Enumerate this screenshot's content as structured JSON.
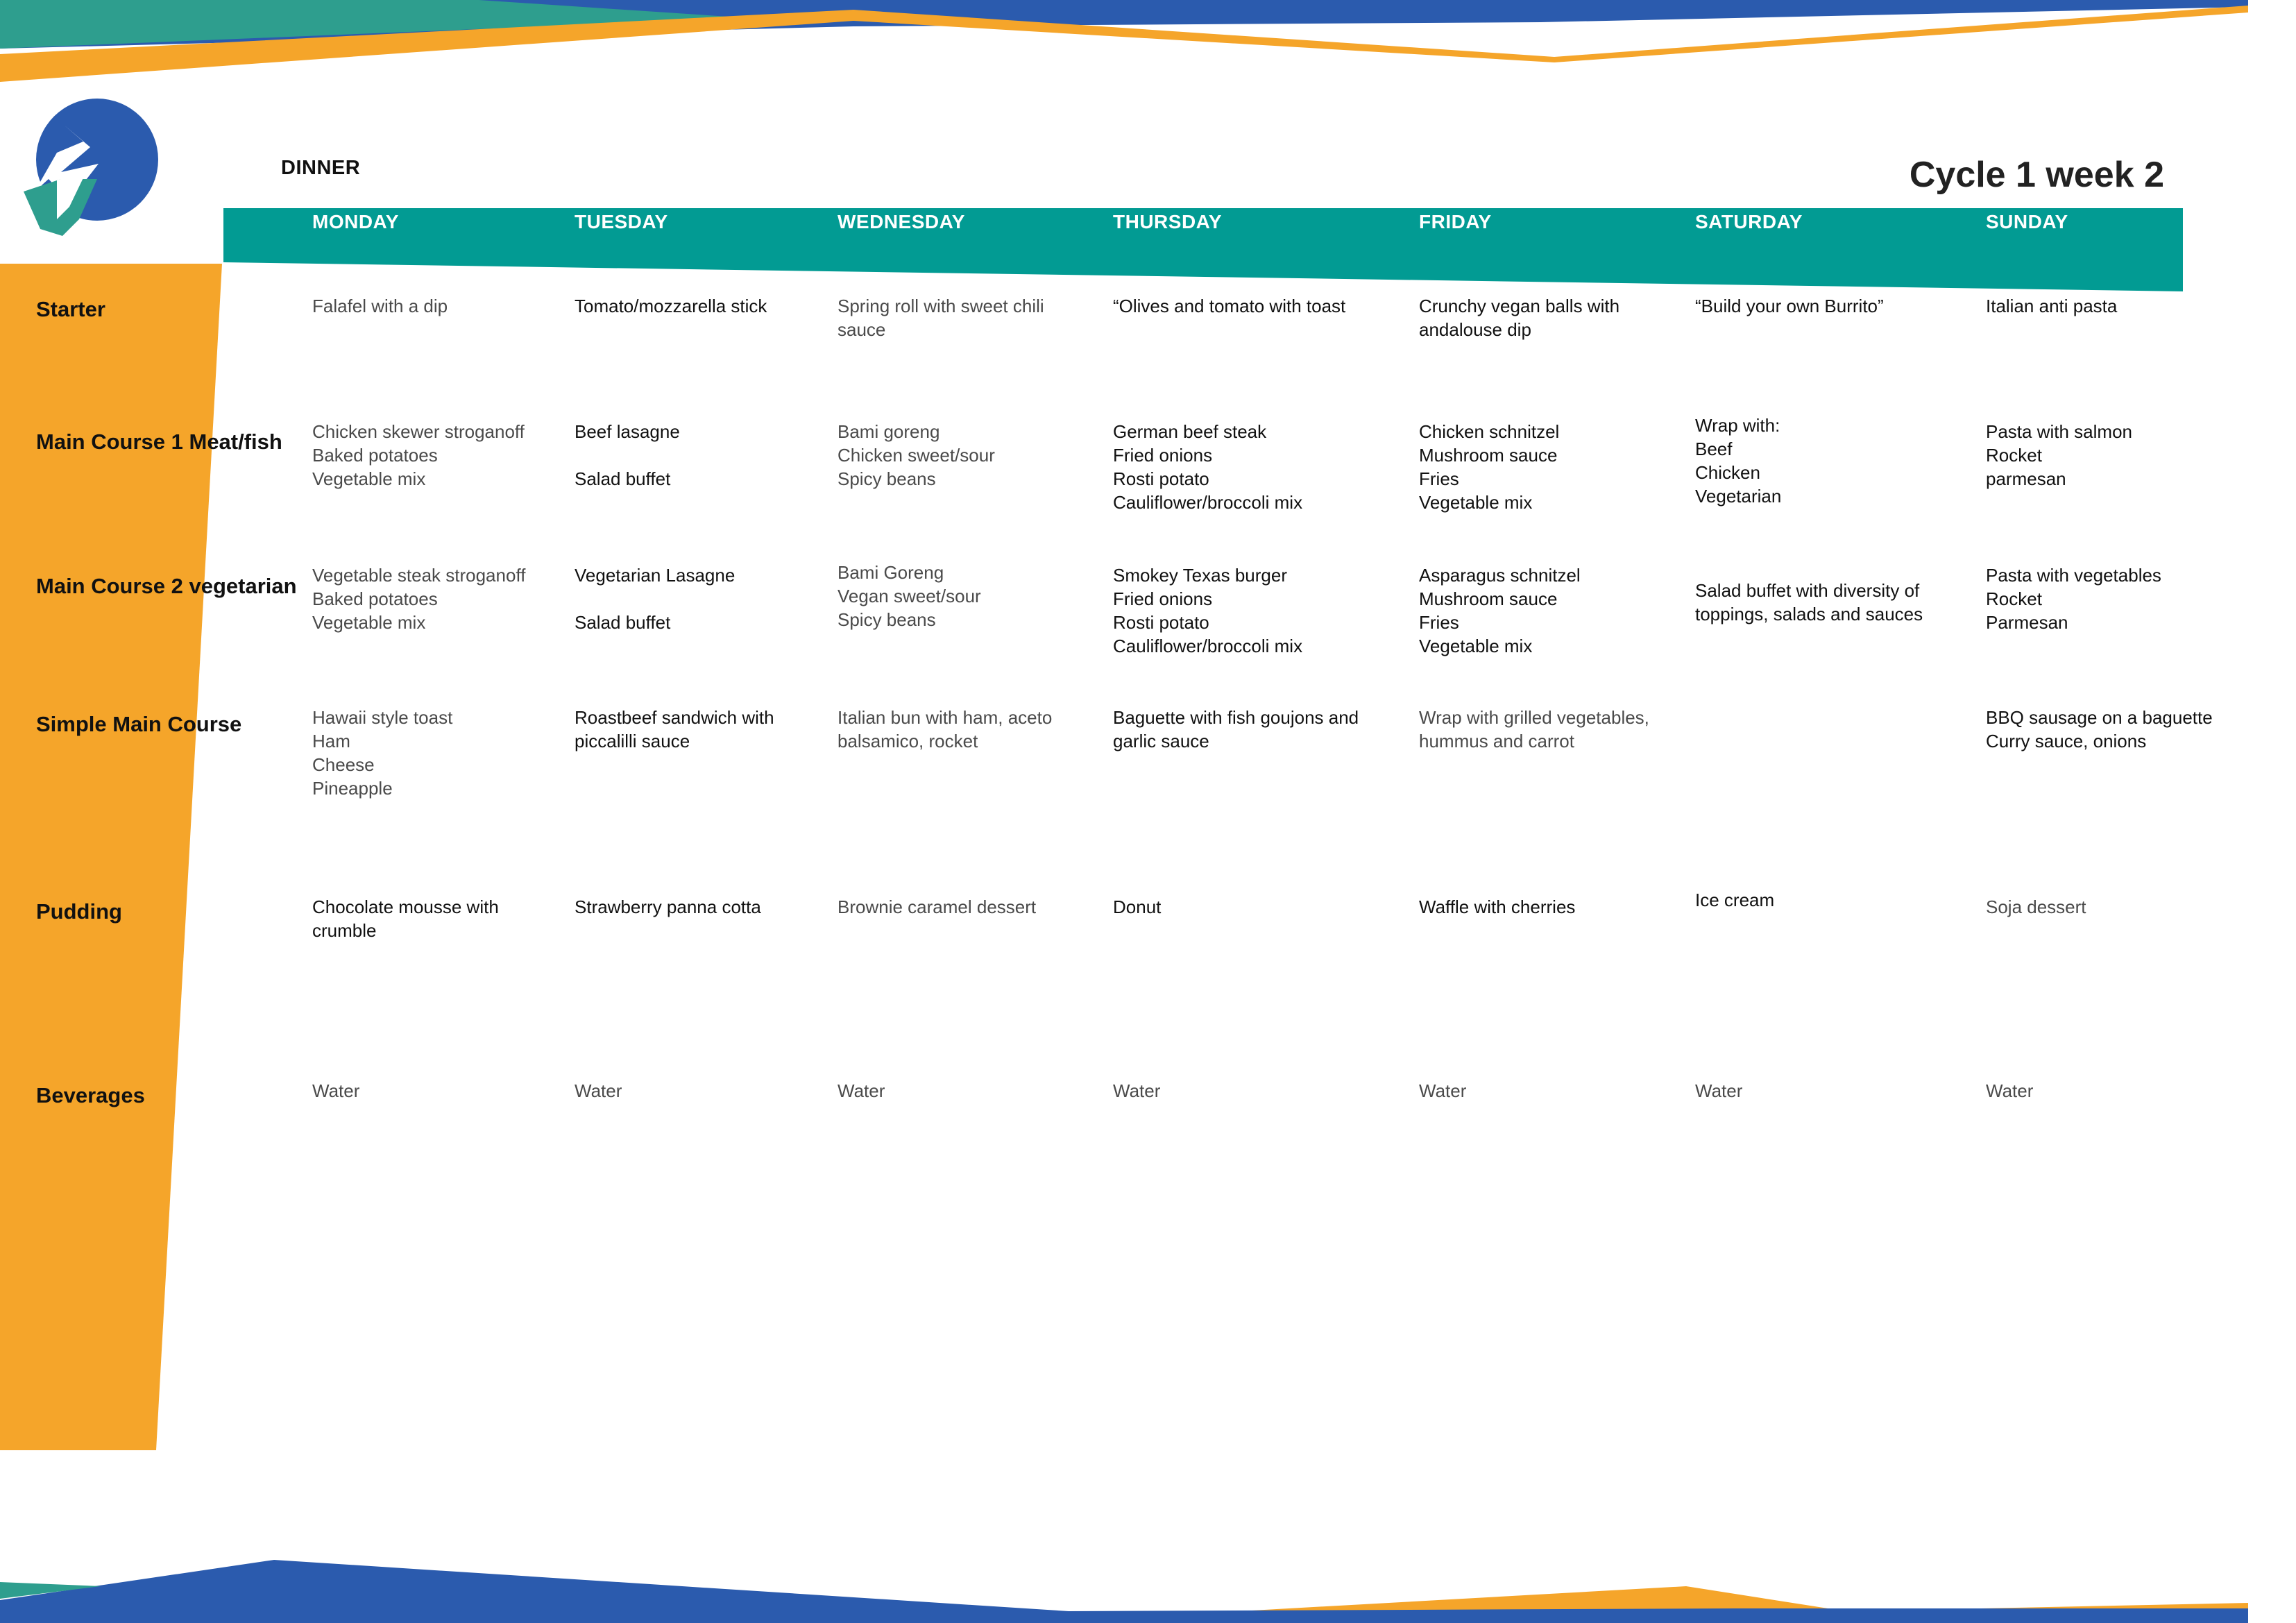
{
  "meal_title": "DINNER",
  "cycle_title": "Cycle 1 week 2",
  "colors": {
    "teal": "#029B93",
    "orange": "#F5A52A",
    "blue": "#2B5BAE",
    "green": "#2E9E8E"
  },
  "logo": {
    "icon": "lightning-circle-logo"
  },
  "days": [
    "MONDAY",
    "TUESDAY",
    "WEDNESDAY",
    "THURSDAY",
    "FRIDAY",
    "SATURDAY",
    "SUNDAY"
  ],
  "rows": [
    {
      "label": "Starter",
      "cells": [
        "Falafel with a dip",
        "Tomato/mozzarella stick",
        "Spring roll with sweet chili\nsauce",
        "“Olives and tomato with toast",
        "Crunchy vegan balls with\nandalouse dip",
        "“Build your own Burrito”",
        "Italian anti pasta"
      ]
    },
    {
      "label": "Main Course 1\nMeat/fish",
      "cells": [
        "Chicken skewer stroganoff\nBaked potatoes\nVegetable mix",
        "Beef lasagne\n\nSalad buffet",
        "Bami goreng\nChicken sweet/sour\nSpicy beans",
        "German beef steak\nFried onions\nRosti potato\nCauliflower/broccoli mix",
        "Chicken schnitzel\nMushroom sauce\nFries\nVegetable mix",
        "Wrap with:\nBeef\nChicken\nVegetarian",
        "Pasta with salmon\nRocket\nparmesan"
      ]
    },
    {
      "label": "Main Course 2\nvegetarian",
      "cells": [
        "Vegetable steak stroganoff\nBaked potatoes\nVegetable mix",
        "Vegetarian Lasagne\n\nSalad buffet",
        "Bami Goreng\nVegan sweet/sour\nSpicy beans",
        "Smokey Texas burger\nFried onions\nRosti potato\nCauliflower/broccoli mix",
        "Asparagus schnitzel\nMushroom sauce\nFries\nVegetable mix",
        "Salad buffet with diversity of\ntoppings, salads and sauces",
        "Pasta with vegetables\nRocket\nParmesan"
      ]
    },
    {
      "label": "Simple Main\nCourse",
      "cells": [
        "Hawaii style toast\nHam\nCheese\nPineapple",
        "Roastbeef sandwich with\npiccalilli sauce",
        "Italian bun with ham, aceto\nbalsamico, rocket",
        "Baguette with fish goujons and\ngarlic sauce",
        "Wrap with grilled vegetables,\nhummus and carrot",
        "",
        "BBQ sausage on a baguette\nCurry sauce, onions"
      ]
    },
    {
      "label": "Pudding",
      "cells": [
        "Chocolate mousse with\ncrumble",
        "Strawberry panna cotta",
        "Brownie caramel dessert",
        "Donut",
        "Waffle with cherries",
        "Ice cream",
        "Soja dessert"
      ]
    },
    {
      "label": "Beverages",
      "cells": [
        "Water",
        "Water",
        "Water",
        "Water",
        "Water",
        "Water",
        "Water"
      ]
    }
  ]
}
